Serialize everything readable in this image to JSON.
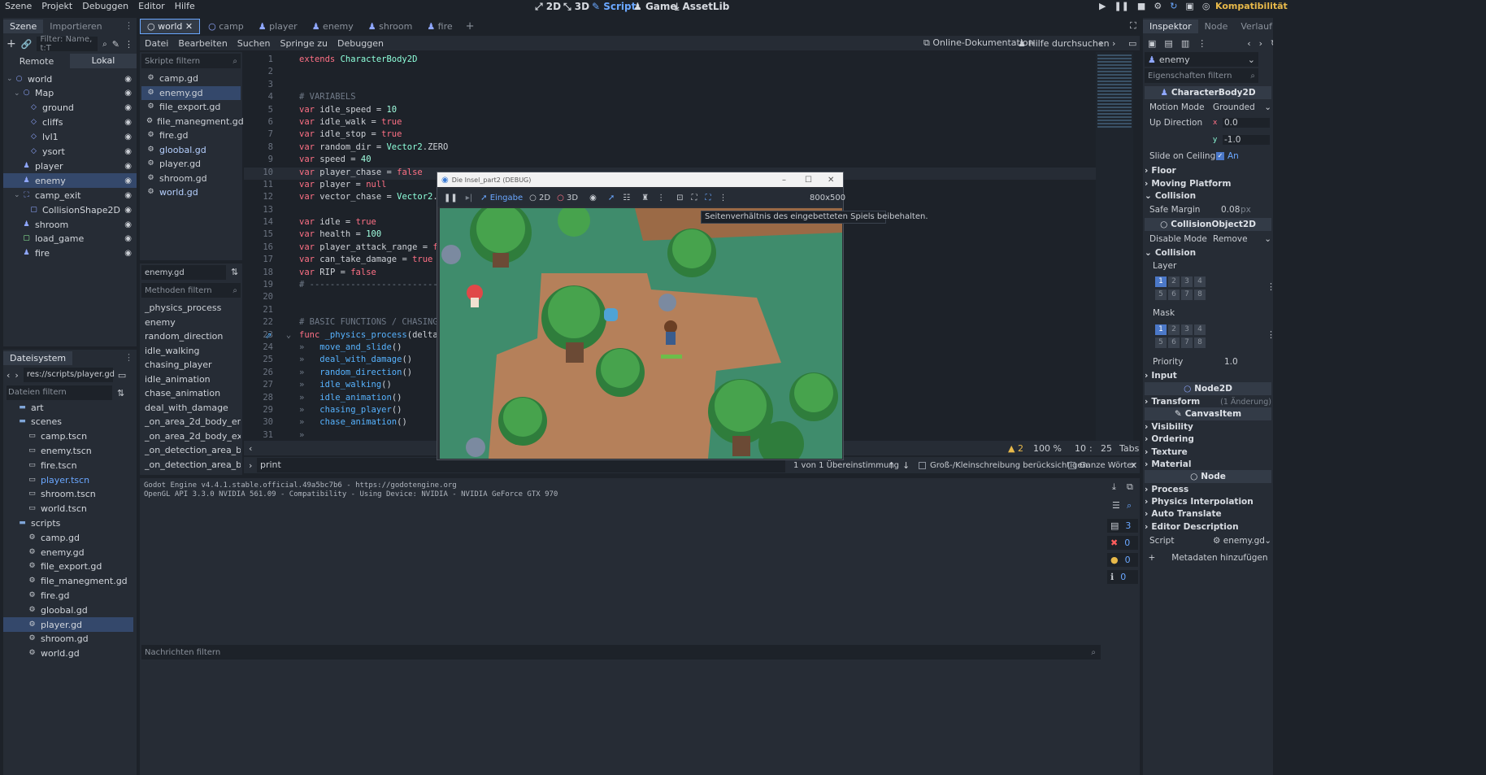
{
  "top": {
    "menus": [
      "Szene",
      "Projekt",
      "Debuggen",
      "Editor",
      "Hilfe"
    ],
    "modes": [
      "2D",
      "3D",
      "Script",
      "Game",
      "AssetLib"
    ],
    "active_mode": "Script",
    "renderer": "Kompatibilität"
  },
  "scene_panel": {
    "tabs": [
      "Szene",
      "Importieren"
    ],
    "filter_placeholder": "Filter: Name, t:T",
    "remote_label": "Remote",
    "local_label": "Lokal",
    "tree": [
      {
        "label": "world",
        "depth": 0,
        "icon": "node2d-icon"
      },
      {
        "label": "Map",
        "depth": 1,
        "icon": "node2d-icon"
      },
      {
        "label": "ground",
        "depth": 2,
        "icon": "tilemap-icon"
      },
      {
        "label": "cliffs",
        "depth": 2,
        "icon": "tilemap-icon"
      },
      {
        "label": "lvl1",
        "depth": 2,
        "icon": "tilemap-icon"
      },
      {
        "label": "ysort",
        "depth": 2,
        "icon": "tilemap-icon"
      },
      {
        "label": "player",
        "depth": 1,
        "icon": "character-icon"
      },
      {
        "label": "enemy",
        "depth": 1,
        "icon": "character-icon"
      },
      {
        "label": "camp_exit",
        "depth": 1,
        "icon": "area-icon"
      },
      {
        "label": "CollisionShape2D",
        "depth": 2,
        "icon": "collision-icon"
      },
      {
        "label": "shroom",
        "depth": 1,
        "icon": "character-icon"
      },
      {
        "label": "load_game",
        "depth": 1,
        "icon": "control-icon"
      },
      {
        "label": "fire",
        "depth": 1,
        "icon": "character-icon"
      }
    ]
  },
  "filesystem": {
    "title": "Dateisystem",
    "path": "res://scripts/player.gd",
    "filter_placeholder": "Dateien filtern",
    "items": [
      {
        "label": "art",
        "depth": 1,
        "type": "folder"
      },
      {
        "label": "scenes",
        "depth": 1,
        "type": "folder"
      },
      {
        "label": "camp.tscn",
        "depth": 2,
        "type": "scene"
      },
      {
        "label": "enemy.tscn",
        "depth": 2,
        "type": "scene"
      },
      {
        "label": "fire.tscn",
        "depth": 2,
        "type": "scene"
      },
      {
        "label": "player.tscn",
        "depth": 2,
        "type": "scene"
      },
      {
        "label": "shroom.tscn",
        "depth": 2,
        "type": "scene"
      },
      {
        "label": "world.tscn",
        "depth": 2,
        "type": "scene"
      },
      {
        "label": "scripts",
        "depth": 1,
        "type": "folder"
      },
      {
        "label": "camp.gd",
        "depth": 2,
        "type": "script"
      },
      {
        "label": "enemy.gd",
        "depth": 2,
        "type": "script"
      },
      {
        "label": "file_export.gd",
        "depth": 2,
        "type": "script"
      },
      {
        "label": "file_manegment.gd",
        "depth": 2,
        "type": "script"
      },
      {
        "label": "fire.gd",
        "depth": 2,
        "type": "script"
      },
      {
        "label": "gloobal.gd",
        "depth": 2,
        "type": "script"
      },
      {
        "label": "player.gd",
        "depth": 2,
        "type": "script"
      },
      {
        "label": "shroom.gd",
        "depth": 2,
        "type": "script"
      },
      {
        "label": "world.gd",
        "depth": 2,
        "type": "script"
      }
    ]
  },
  "scene_tabs": [
    "world",
    "camp",
    "player",
    "enemy",
    "shroom",
    "fire"
  ],
  "script_menu": {
    "items": [
      "Datei",
      "Bearbeiten",
      "Suchen",
      "Springe zu",
      "Debuggen"
    ],
    "online_docs": "Online-Dokumentation",
    "help_search": "Hilfe durchsuchen"
  },
  "scripts_list": {
    "filter_placeholder": "Skripte filtern",
    "items": [
      "camp.gd",
      "enemy.gd",
      "file_export.gd",
      "file_manegment.gd",
      "fire.gd",
      "gloobal.gd",
      "player.gd",
      "shroom.gd",
      "world.gd"
    ],
    "current": "enemy.gd"
  },
  "methods": {
    "filter_placeholder": "Methoden filtern",
    "items": [
      "_physics_process",
      "enemy",
      "random_direction",
      "idle_walking",
      "chasing_player",
      "idle_animation",
      "chase_animation",
      "deal_with_damage",
      "_on_area_2d_body_enter...",
      "_on_area_2d_body_exited",
      "_on_detection_area_bod...",
      "_on_detection_area_bod..."
    ]
  },
  "code": [
    {
      "n": "1",
      "t": [
        [
          "kw",
          "extends "
        ],
        [
          "ty",
          "CharacterBody2D"
        ]
      ]
    },
    {
      "n": "2",
      "t": []
    },
    {
      "n": "3",
      "t": []
    },
    {
      "n": "4",
      "t": [
        [
          "cm",
          "# VARIABELS"
        ]
      ]
    },
    {
      "n": "5",
      "t": [
        [
          "kw",
          "var "
        ],
        [
          "id",
          "idle_speed = "
        ],
        [
          "nm",
          "10"
        ]
      ]
    },
    {
      "n": "6",
      "t": [
        [
          "kw",
          "var "
        ],
        [
          "id",
          "idle_walk = "
        ],
        [
          "kw",
          "true"
        ]
      ]
    },
    {
      "n": "7",
      "t": [
        [
          "kw",
          "var "
        ],
        [
          "id",
          "idle_stop = "
        ],
        [
          "kw",
          "true"
        ]
      ]
    },
    {
      "n": "8",
      "t": [
        [
          "kw",
          "var "
        ],
        [
          "id",
          "random_dir = "
        ],
        [
          "ty",
          "Vector2"
        ],
        [
          "id",
          ".ZERO"
        ]
      ]
    },
    {
      "n": "9",
      "t": [
        [
          "kw",
          "var "
        ],
        [
          "id",
          "speed = "
        ],
        [
          "nm",
          "40"
        ]
      ]
    },
    {
      "n": "10",
      "t": [
        [
          "kw",
          "var "
        ],
        [
          "id",
          "player_chase = "
        ],
        [
          "kw",
          "false"
        ]
      ]
    },
    {
      "n": "11",
      "t": [
        [
          "kw",
          "var "
        ],
        [
          "id",
          "player = "
        ],
        [
          "kw",
          "null"
        ]
      ]
    },
    {
      "n": "12",
      "t": [
        [
          "kw",
          "var "
        ],
        [
          "id",
          "vector_chase = "
        ],
        [
          "ty",
          "Vector2"
        ],
        [
          "id",
          ".ZERO"
        ]
      ]
    },
    {
      "n": "13",
      "t": []
    },
    {
      "n": "14",
      "t": [
        [
          "kw",
          "var "
        ],
        [
          "id",
          "idle = "
        ],
        [
          "kw",
          "true"
        ]
      ]
    },
    {
      "n": "15",
      "t": [
        [
          "kw",
          "var "
        ],
        [
          "id",
          "health = "
        ],
        [
          "nm",
          "100"
        ]
      ]
    },
    {
      "n": "16",
      "t": [
        [
          "kw",
          "var "
        ],
        [
          "id",
          "player_attack_range = "
        ],
        [
          "kw",
          "false"
        ]
      ]
    },
    {
      "n": "17",
      "t": [
        [
          "kw",
          "var "
        ],
        [
          "id",
          "can_take_damage = "
        ],
        [
          "kw",
          "true"
        ]
      ]
    },
    {
      "n": "18",
      "t": [
        [
          "kw",
          "var "
        ],
        [
          "id",
          "RIP = "
        ],
        [
          "kw",
          "false"
        ]
      ]
    },
    {
      "n": "19",
      "t": [
        [
          "cm",
          "# ----------------------------------"
        ]
      ]
    },
    {
      "n": "20",
      "t": []
    },
    {
      "n": "21",
      "t": []
    },
    {
      "n": "22",
      "t": [
        [
          "cm",
          "# BASIC FUNCTIONS / CHASING PLAYE"
        ]
      ]
    },
    {
      "n": "23",
      "t": [
        [
          "kw",
          "func "
        ],
        [
          "fn",
          "_physics_process"
        ],
        [
          "id",
          "(delta: flo"
        ]
      ]
    },
    {
      "n": "24",
      "t": [
        [
          "cm",
          "»   "
        ],
        [
          "fn",
          "move_and_slide"
        ],
        [
          "id",
          "()"
        ]
      ]
    },
    {
      "n": "25",
      "t": [
        [
          "cm",
          "»   "
        ],
        [
          "fn",
          "deal_with_damage"
        ],
        [
          "id",
          "()"
        ]
      ]
    },
    {
      "n": "26",
      "t": [
        [
          "cm",
          "»   "
        ],
        [
          "fn",
          "random_direction"
        ],
        [
          "id",
          "()"
        ]
      ]
    },
    {
      "n": "27",
      "t": [
        [
          "cm",
          "»   "
        ],
        [
          "fn",
          "idle_walking"
        ],
        [
          "id",
          "()"
        ]
      ]
    },
    {
      "n": "28",
      "t": [
        [
          "cm",
          "»   "
        ],
        [
          "fn",
          "idle_animation"
        ],
        [
          "id",
          "()"
        ]
      ]
    },
    {
      "n": "29",
      "t": [
        [
          "cm",
          "»   "
        ],
        [
          "fn",
          "chasing_player"
        ],
        [
          "id",
          "()"
        ]
      ]
    },
    {
      "n": "30",
      "t": [
        [
          "cm",
          "»   "
        ],
        [
          "fn",
          "chase_animation"
        ],
        [
          "id",
          "()"
        ]
      ]
    },
    {
      "n": "31",
      "t": [
        [
          "cm",
          "»"
        ]
      ]
    }
  ],
  "editor_status": {
    "warnings": "2",
    "zoom": "100 %",
    "line": "10",
    "col": "25",
    "indent": "Tabs"
  },
  "search": {
    "value": "print",
    "matches": "1 von 1 Übereinstimmung",
    "case_label": "Groß-/Kleinschreibung berücksichtigen",
    "words_label": "Ganze Wörter"
  },
  "output": {
    "lines": [
      "Godot Engine v4.4.1.stable.official.49a5bc7b6 - https://godotengine.org",
      "OpenGL API 3.3.0 NVIDIA 561.09 - Compatibility - Using Device: NVIDIA - NVIDIA GeForce GTX 970"
    ],
    "filter_placeholder": "Nachrichten filtern",
    "counts": {
      "all": "3",
      "errors": "0",
      "warnings": "0",
      "info": "0"
    }
  },
  "game_window": {
    "title": "Die Insel_part2 (DEBUG)",
    "input_label": "Eingabe",
    "label_2d": "2D",
    "label_3d": "3D",
    "resolution": "800x500",
    "tooltip": "Seitenverhältnis des eingebetteten Spiels beibehalten."
  },
  "inspector": {
    "tabs": [
      "Inspektor",
      "Node",
      "Verlauf"
    ],
    "node_name": "enemy",
    "filter_placeholder": "Eigenschaften filtern",
    "class_header": "CharacterBody2D",
    "motion_mode_label": "Motion Mode",
    "motion_mode_value": "Grounded",
    "up_direction_label": "Up Direction",
    "up_x": "0.0",
    "up_y": "-1.0",
    "slide_label": "Slide on Ceiling",
    "slide_value": "An",
    "floor": "Floor",
    "moving_platform": "Moving Platform",
    "collision_section": "Collision",
    "safe_margin_label": "Safe Margin",
    "safe_margin_value": "0.08",
    "safe_margin_unit": "px",
    "collision_object_header": "CollisionObject2D",
    "disable_mode_label": "Disable Mode",
    "disable_mode_value": "Remove",
    "collision_sub": "Collision",
    "layer_label": "Layer",
    "mask_label": "Mask",
    "layer_bits": [
      "1",
      "2",
      "3",
      "4",
      "5",
      "6",
      "7",
      "8"
    ],
    "priority_label": "Priority",
    "priority_value": "1.0",
    "input_section": "Input",
    "node2d_header": "Node2D",
    "transform_section": "Transform",
    "transform_changes": "(1 Änderung)",
    "canvas_header": "CanvasItem",
    "visibility": "Visibility",
    "ordering": "Ordering",
    "texture": "Texture",
    "material": "Material",
    "node_header": "Node",
    "process": "Process",
    "physics_interp": "Physics Interpolation",
    "auto_translate": "Auto Translate",
    "editor_desc": "Editor Description",
    "script_label": "Script",
    "script_value": "enemy.gd",
    "add_meta": "Metadaten hinzufügen"
  },
  "colors": {
    "accent": "#4b78c8",
    "selection": "#34486b",
    "keyword": "#ff7085",
    "type": "#8effda",
    "function": "#57b3ff"
  }
}
